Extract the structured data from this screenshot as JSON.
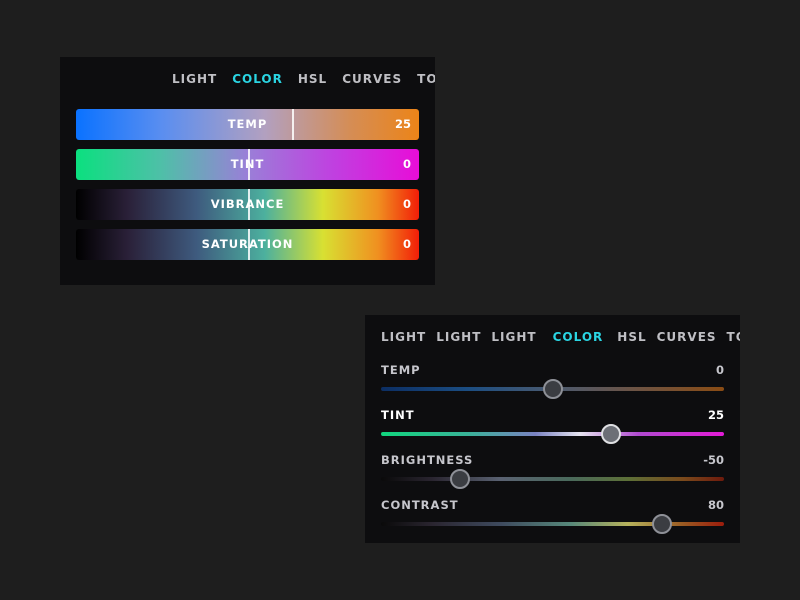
{
  "panel1": {
    "tabs": [
      {
        "label": "LIGHT",
        "active": false
      },
      {
        "label": "COLOR",
        "active": true
      },
      {
        "label": "HSL",
        "active": false
      },
      {
        "label": "CURVES",
        "active": false
      },
      {
        "label": "TONING",
        "active": false
      }
    ],
    "bars": [
      {
        "label": "TEMP",
        "value": "25",
        "marker_level": 0.63
      },
      {
        "label": "TINT",
        "value": "0",
        "marker_level": 0.5
      },
      {
        "label": "VIBRANCE",
        "value": "0",
        "marker_level": 0.5
      },
      {
        "label": "SATURATION",
        "value": "0",
        "marker_level": 0.5
      }
    ]
  },
  "panel2": {
    "tabs": [
      {
        "label": "LIGHT",
        "active": false
      },
      {
        "label": "LIGHT",
        "active": false
      },
      {
        "label": "LIGHT",
        "active": false
      },
      {
        "label": "COLOR",
        "active": true
      },
      {
        "label": "HSL",
        "active": false
      },
      {
        "label": "CURVES",
        "active": false
      },
      {
        "label": "TONING",
        "active": false
      }
    ],
    "sliders": [
      {
        "label": "TEMP",
        "value": "0",
        "level": 0.5,
        "active": false
      },
      {
        "label": "TINT",
        "value": "25",
        "level": 0.67,
        "active": true
      },
      {
        "label": "BRIGHTNESS",
        "value": "-50",
        "level": 0.23,
        "active": false
      },
      {
        "label": "CONTRAST",
        "value": "80",
        "level": 0.82,
        "active": false
      }
    ]
  },
  "colors": {
    "background": "#1e1e1e",
    "panel": "#0d0d0f",
    "accent": "#2ad5e3",
    "text": "#bfbfc4"
  }
}
